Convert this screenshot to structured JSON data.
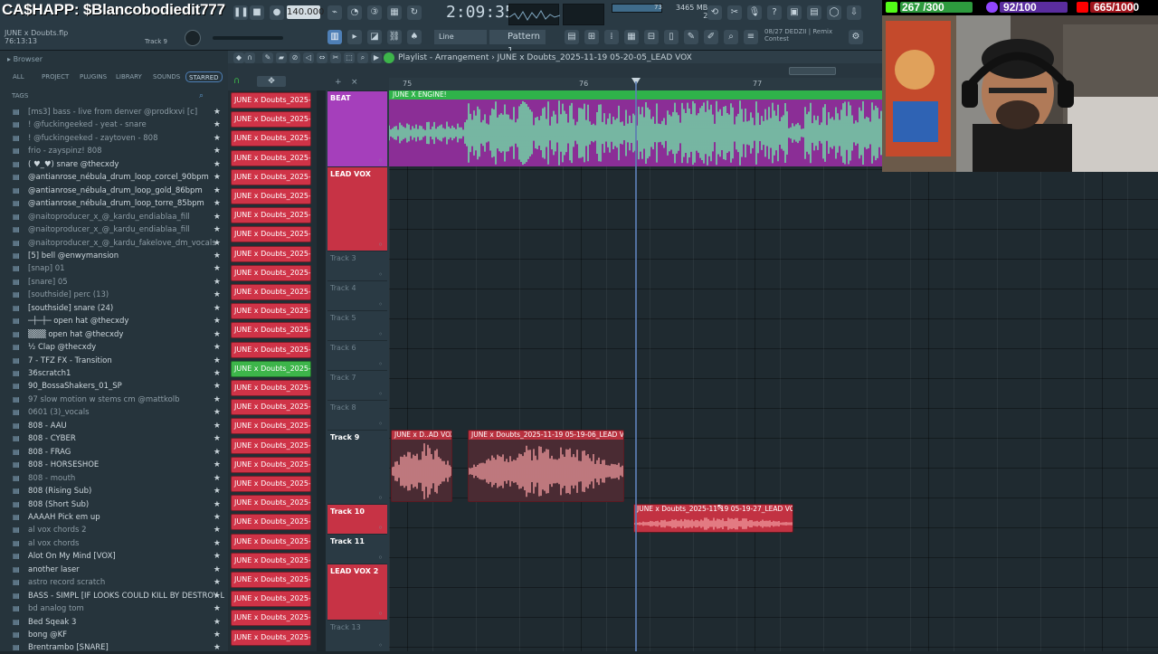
{
  "overlay": {
    "cashapp": "CA$HAPP: $Blancobodiedit777"
  },
  "toolbar": {
    "tempo": "140.000",
    "timecode": "2:09:35",
    "mem_top": "3465 MB",
    "mem_bottom": "2",
    "pattern": "Pattern 1",
    "snap": "Line",
    "info_date": "08/27  DEDZII | Remix",
    "info_sub": "Contest",
    "counter_a": "73"
  },
  "project": {
    "filename": "JUNE x Doubts.flp",
    "elapsed": "76:13:13",
    "channel": "Track 9"
  },
  "browser": {
    "title": "Browser",
    "tabs": [
      "ALL",
      "PROJECT",
      "PLUGINS",
      "LIBRARY",
      "SOUNDS",
      "STARRED"
    ],
    "tags_label": "TAGS",
    "items": [
      {
        "label": "[ms3] bass - live from denver @prodkxvi [c]",
        "dim": true
      },
      {
        "label": "! @fuckingeeked - yeat - snare",
        "dim": true
      },
      {
        "label": "! @fuckingeeked - zaytoven - 808",
        "dim": true
      },
      {
        "label": "frio - zayspinz! 808",
        "dim": true
      },
      {
        "label": "( ♥_♥) snare @thecxdy",
        "dim": false
      },
      {
        "label": "@antianrose_nébula_drum_loop_corcel_90bpm",
        "dim": false
      },
      {
        "label": "@antianrose_nébula_drum_loop_gold_86bpm",
        "dim": false
      },
      {
        "label": "@antianrose_nébula_drum_loop_torre_85bpm",
        "dim": false
      },
      {
        "label": "@naitoproducer_x_@_kardu_endiablaa_fill",
        "dim": true
      },
      {
        "label": "@naitoproducer_x_@_kardu_endiablaa_fill",
        "dim": true
      },
      {
        "label": "@naitoproducer_x_@_kardu_fakelove_dm_vocals",
        "dim": true
      },
      {
        "label": "[5] bell @enwymansion",
        "dim": false
      },
      {
        "label": "[snap] 01",
        "dim": true
      },
      {
        "label": "[snare] 05",
        "dim": true
      },
      {
        "label": "[southside] perc (13)",
        "dim": true
      },
      {
        "label": "[southside] snare (24)",
        "dim": false
      },
      {
        "label": "─┼─┼─ open hat @thecxdy",
        "dim": false
      },
      {
        "label": "▒▒▒ open hat @thecxdy",
        "dim": false
      },
      {
        "label": "½ Clap @thecxdy",
        "dim": false
      },
      {
        "label": "7 - TFZ FX - Transition",
        "dim": false
      },
      {
        "label": "36scratch1",
        "dim": false
      },
      {
        "label": "90_BossaShakers_01_SP",
        "dim": false
      },
      {
        "label": "97 slow motion w stems cm @mattkolb",
        "dim": true
      },
      {
        "label": "0601 (3)_vocals",
        "dim": true
      },
      {
        "label": "808 - AAU",
        "dim": false
      },
      {
        "label": "808 - CYBER",
        "dim": false
      },
      {
        "label": "808 - FRAG",
        "dim": false
      },
      {
        "label": "808 - HORSESHOE",
        "dim": false
      },
      {
        "label": "808 - mouth",
        "dim": true
      },
      {
        "label": "808 (Rising Sub)",
        "dim": false
      },
      {
        "label": "808 (Short Sub)",
        "dim": false
      },
      {
        "label": "AAAAH Pick em up",
        "dim": false
      },
      {
        "label": "al vox chords 2",
        "dim": true
      },
      {
        "label": "al vox chords",
        "dim": true
      },
      {
        "label": "Alot On My Mind [VOX]",
        "dim": false
      },
      {
        "label": "another laser",
        "dim": false
      },
      {
        "label": "astro record scratch",
        "dim": true
      },
      {
        "label": "BASS - SIMPL [IF LOOKS COULD KILL BY DESTROY LONELY]",
        "dim": false
      },
      {
        "label": "bd analog tom",
        "dim": true
      },
      {
        "label": "Bed Sqeak 3",
        "dim": false
      },
      {
        "label": "bong @KF",
        "dim": false
      },
      {
        "label": "Brentrambo [SNARE]",
        "dim": false
      }
    ]
  },
  "cliplist": {
    "label": "JUNE x Doubts_2025-11-..."
  },
  "playlist": {
    "title": "Playlist - Arrangement › JUNE x Doubts_2025-11-19 05-20-05_LEAD VOX",
    "ruler": [
      "75",
      "76",
      "77"
    ],
    "tracks": [
      "BEAT",
      "LEAD VOX",
      "Track 3",
      "Track 4",
      "Track 5",
      "Track 6",
      "Track 7",
      "Track 8",
      "Track 9",
      "Track 10",
      "Track 11",
      "LEAD VOX 2",
      "Track 13"
    ],
    "clips": {
      "beat": "JUNE X ENGINE!",
      "t9a": "JUNE x D..AD VOX",
      "t9b": "JUNE x Doubts_2025-11-19 05-19-06_LEAD VOX",
      "t10": "JUNE x Doubts_2025-11-19 05-19-27_LEAD VOX"
    }
  },
  "stats": {
    "a": "267 /300",
    "b": "92/100",
    "c": "665/1000",
    "a_level": 0.89,
    "b_level": 0.92,
    "c_level": 0.665
  },
  "colors": {
    "accent": "#4e7fb6",
    "clip_red": "#cf3347",
    "clip_green": "#3db54a",
    "beat_wave": "#6ef0a8",
    "beat_bg": "#8b2e96",
    "vox_wave": "#f19a9e"
  }
}
